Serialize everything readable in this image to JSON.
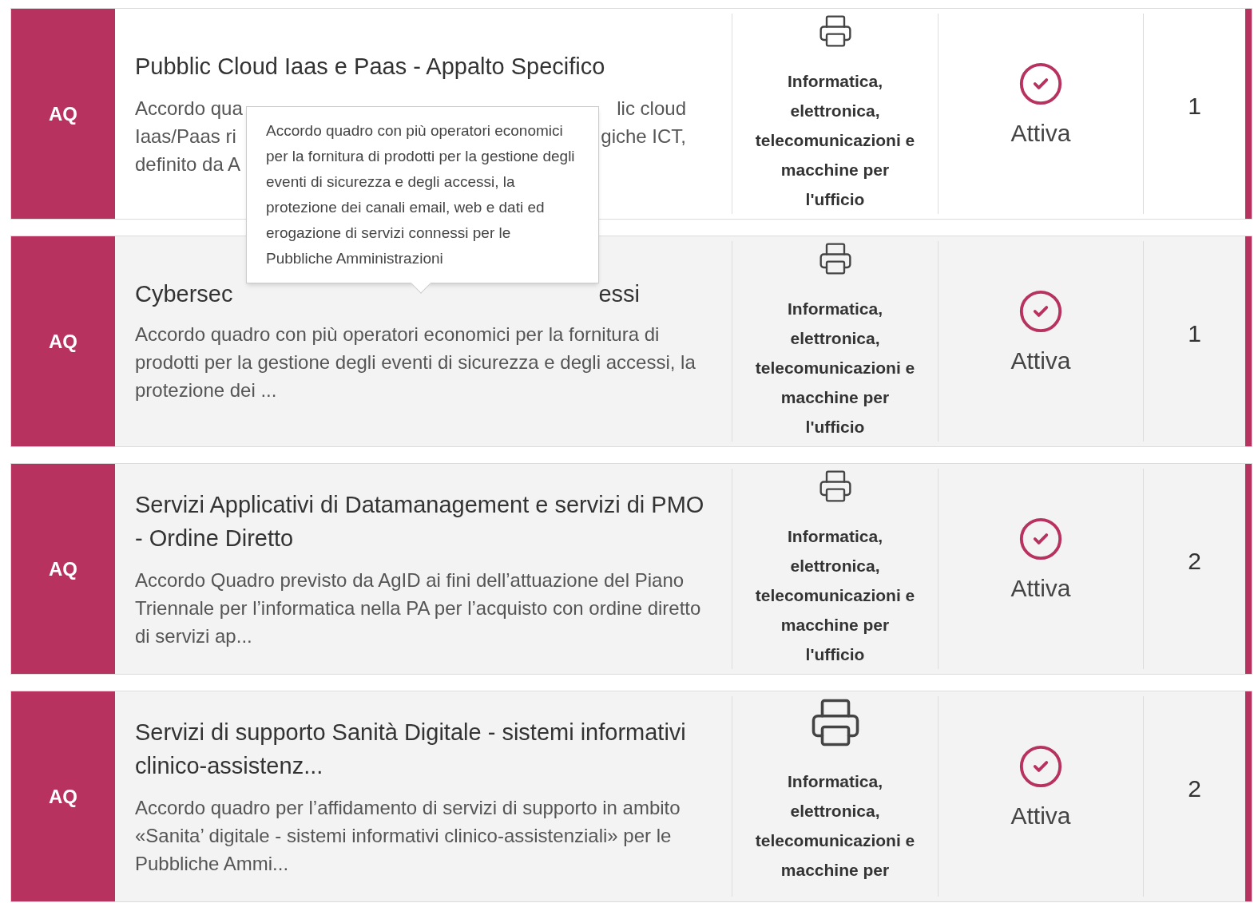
{
  "rows": [
    {
      "badge": "AQ",
      "title": "Pubblic Cloud Iaas e Paas - Appalto Specifico",
      "description_lines": [
        {
          "left": "Accordo qua",
          "right": "lic cloud"
        },
        {
          "left": "Iaas/Paas ri",
          "right": "giche ICT,"
        },
        {
          "left": "definito da A"
        }
      ],
      "category": "Informatica, elettronica, telecomunicazioni e macchine per l'ufficio",
      "status": "Attiva",
      "count": "1",
      "shaded": false
    },
    {
      "badge": "AQ",
      "title_parts": {
        "left": "Cybersec",
        "right": "essi"
      },
      "description": "Accordo quadro con più operatori economici per la fornitura di prodotti per la gestione degli eventi di sicurezza e degli accessi, la protezione dei ...",
      "category": "Informatica, elettronica, telecomunicazioni e macchine per l'ufficio",
      "status": "Attiva",
      "count": "1",
      "shaded": true
    },
    {
      "badge": "AQ",
      "title": "Servizi Applicativi di Datamanagement e servizi di PMO - Ordine Diretto",
      "description": "Accordo Quadro previsto da AgID ai fini dell’attuazione del Piano Triennale per l’informatica nella PA per l’acquisto con ordine diretto di servizi ap...",
      "category": "Informatica, elettronica, telecomunicazioni e macchine per l'ufficio",
      "status": "Attiva",
      "count": "2",
      "shaded": true
    },
    {
      "badge": "AQ",
      "title": "Servizi di supporto Sanità Digitale - sistemi informativi clinico-assistenz...",
      "description": "Accordo quadro per l’affidamento di servizi di supporto in ambito «Sanita’ digitale - sistemi informativi clinico-assistenziali» per le Pubbliche Ammi...",
      "category": "Informatica, elettronica, telecomunicazioni e macchine per",
      "status": "Attiva",
      "count": "2",
      "shaded": true
    }
  ],
  "tooltip": {
    "text": "Accordo quadro con più operatori economici per la fornitura di prodotti per la gestione degli eventi di sicurezza e degli accessi, la protezione dei canali email, web e dati ed erogazione di servizi connessi per le Pubbliche Amministrazioni"
  }
}
